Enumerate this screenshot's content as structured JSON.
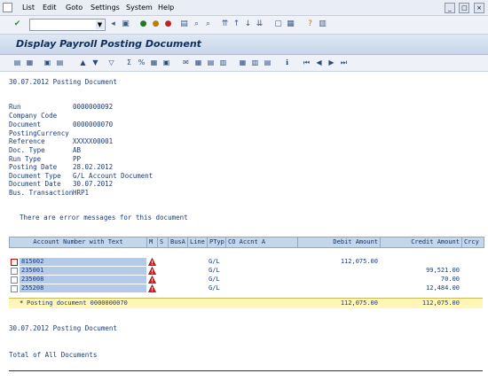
{
  "menu": {
    "items": [
      "List",
      "Edit",
      "Goto",
      "Settings",
      "System",
      "Help"
    ]
  },
  "window": {
    "title": "Display Payroll Posting Document"
  },
  "report": {
    "header_line": "30.07.2012 Posting Document",
    "fields": [
      {
        "label": "Run",
        "value": "0000000092"
      },
      {
        "label": "Company Code",
        "value": ""
      },
      {
        "label": "Document",
        "value": "0000000070"
      },
      {
        "label": "PostingCurrency",
        "value": ""
      },
      {
        "label": "Reference",
        "value": "XXXXX00001"
      },
      {
        "label": "Doc. Type",
        "value": "AB"
      },
      {
        "label": "Run Type",
        "value": "PP"
      },
      {
        "label": "Posting Date",
        "value": "28.02.2012"
      },
      {
        "label": "Document Type",
        "value": "G/L Account Document"
      },
      {
        "label": "Document Date",
        "value": "30.07.2012"
      },
      {
        "label": "Bus. Transaction",
        "value": "HRP1"
      }
    ],
    "error_message": "There are error messages for this document",
    "table": {
      "headers": [
        "Account Number with Text",
        "M",
        "S",
        "BusA",
        "Line",
        "PTyp",
        "CO Accnt A",
        "Debit Amount",
        "Credit Amount",
        "Crcy"
      ],
      "rows": [
        {
          "account": "815002",
          "ptyp": "G/L",
          "debit": "112,075.00",
          "credit": ""
        },
        {
          "account": "235001",
          "ptyp": "G/L",
          "debit": "",
          "credit": "99,521.00"
        },
        {
          "account": "235008",
          "ptyp": "G/L",
          "debit": "",
          "credit": "70.00"
        },
        {
          "account": "255208",
          "ptyp": "G/L",
          "debit": "",
          "credit": "12,484.00"
        }
      ],
      "total": {
        "label": "Posting document 0000000070",
        "marker": "*",
        "debit": "112,075.00",
        "credit": "112,075.00"
      }
    },
    "footer_line": "30.07.2012 Posting Document",
    "summary_label": "Total of All Documents"
  }
}
